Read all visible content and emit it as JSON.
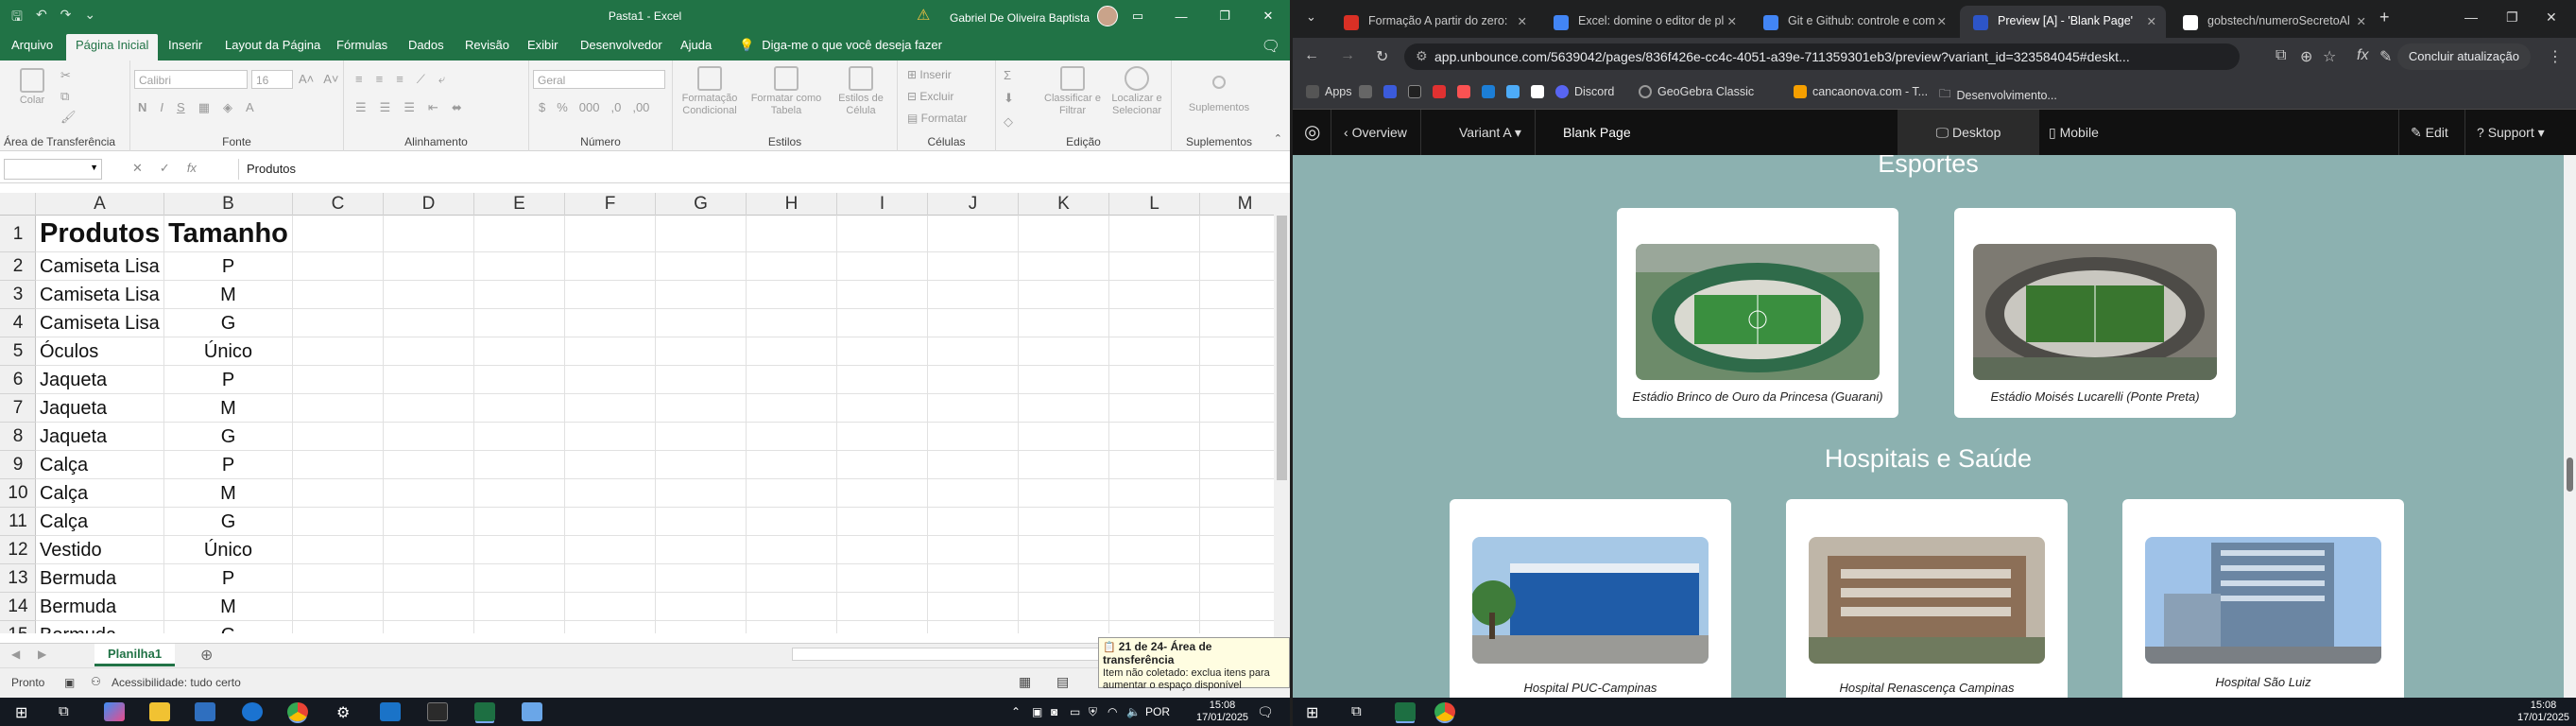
{
  "excel": {
    "title": "Pasta1 - Excel",
    "user": "Gabriel De Oliveira Baptista",
    "menu_tabs": [
      "Arquivo",
      "Página Inicial",
      "Inserir",
      "Layout da Página",
      "Fórmulas",
      "Dados",
      "Revisão",
      "Exibir",
      "Desenvolvedor",
      "Ajuda"
    ],
    "tell_me": "Diga-me o que você deseja fazer",
    "ribbon": {
      "paste": "Colar",
      "clipboard": "Área de Transferência",
      "font_group": "Fonte",
      "font_name": "Calibri",
      "font_size": "16",
      "align_group": "Alinhamento",
      "number_group": "Número",
      "number_format": "Geral",
      "styles_group": "Estilos",
      "cond_format": "Formatação Condicional",
      "format_table": "Formatar como Tabela",
      "cell_styles": "Estilos de Célula",
      "cells_group": "Células",
      "insert": "Inserir",
      "delete": "Excluir",
      "format": "Formatar",
      "edit_group": "Edição",
      "sort_filter": "Classificar e Filtrar",
      "find_select": "Localizar e Selecionar",
      "addins_group": "Suplementos",
      "addins": "Suplementos"
    },
    "formula_value": "Produtos",
    "columns": [
      "A",
      "B",
      "C",
      "D",
      "E",
      "F",
      "G",
      "H",
      "I",
      "J",
      "K",
      "L",
      "M"
    ],
    "rows": [
      [
        "Produtos",
        "Tamanho"
      ],
      [
        "Camiseta Lisa",
        "P"
      ],
      [
        "Camiseta Lisa",
        "M"
      ],
      [
        "Camiseta Lisa",
        "G"
      ],
      [
        "Óculos",
        "Único"
      ],
      [
        "Jaqueta",
        "P"
      ],
      [
        "Jaqueta",
        "M"
      ],
      [
        "Jaqueta",
        "G"
      ],
      [
        "Calça",
        "P"
      ],
      [
        "Calça",
        "M"
      ],
      [
        "Calça",
        "G"
      ],
      [
        "Vestido",
        "Único"
      ],
      [
        "Bermuda",
        "P"
      ],
      [
        "Bermuda",
        "M"
      ],
      [
        "Bermuda",
        "G"
      ]
    ],
    "sheet_tab": "Planilha1",
    "status": "Pronto",
    "accessibility": "Acessibilidade: tudo certo",
    "clipboard_note": {
      "title": "21 de 24- Área de transferência",
      "line1": "Item não coletado: exclua itens para",
      "line2": "aumentar o espaço disponível"
    }
  },
  "chrome": {
    "tabs": [
      {
        "title": "Formação A partir do zero:",
        "color": "#d93025"
      },
      {
        "title": "Excel: domine o editor de pl",
        "color": "#4285f4"
      },
      {
        "title": "Git e Github: controle e com",
        "color": "#4285f4"
      },
      {
        "title": "Preview [A] - 'Blank Page'",
        "color": "#2d55c8"
      },
      {
        "title": "gobstech/numeroSecretoAl",
        "color": "#ffffff"
      }
    ],
    "url": "app.unbounce.com/5639042/pages/836f426e-cc4c-4051-a39e-711359301eb3/preview?variant_id=323584045#deskt...",
    "update_button": "Concluir atualização",
    "bookmarks": [
      "Apps",
      "Discord",
      "GeoGebra Classic",
      "cancaonova.com - T...",
      "Desenvolvimento..."
    ],
    "unbounce": {
      "overview": "Overview",
      "variant": "Variant A",
      "page": "Blank Page",
      "desktop": "Desktop",
      "mobile": "Mobile",
      "edit": "Edit",
      "support": "Support"
    },
    "page": {
      "section1": "Esportes",
      "stadiums": [
        "Estádio Brinco de Ouro da Princesa (Guarani)",
        "Estádio Moisés Lucarelli (Ponte Preta)"
      ],
      "section2": "Hospitais e Saúde",
      "hospitals": [
        "Hospital PUC-Campinas",
        "Hospital Renascença Campinas",
        "Hospital São Luiz"
      ]
    }
  },
  "taskbar": {
    "lang": "POR",
    "time": "15:08",
    "date": "17/01/2025"
  }
}
